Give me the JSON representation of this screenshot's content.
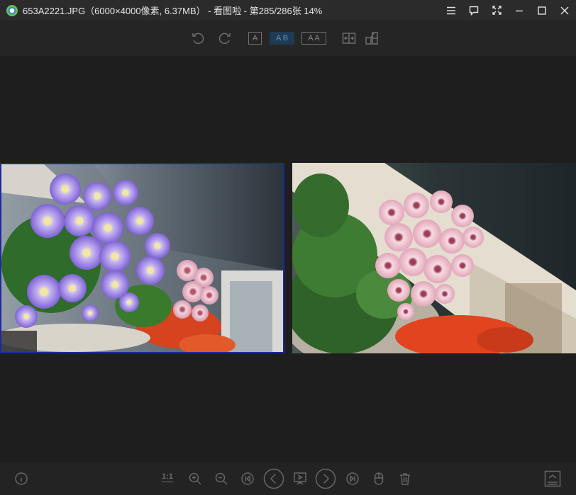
{
  "window": {
    "title": "653A2221.JPG（6000×4000像素, 6.37MB） - 看图啦 - 第285/286张 14%",
    "app_icon": "kantula-logo-icon",
    "controls": [
      "menu-icon",
      "feedback-icon",
      "fullscreen-icon",
      "minimize-icon",
      "maximize-icon",
      "close-icon"
    ]
  },
  "toolbar": {
    "rotate_left": "rotate-left-icon",
    "rotate_right": "rotate-right-icon",
    "single_view_label": "A",
    "compare_ab_label": "A B",
    "compare_aa_label": "A A",
    "sync_icon": "sync-compare-icon",
    "layout_icon": "layout-icon",
    "active_mode": "A B"
  },
  "viewer": {
    "left_image_desc": "purple daisies",
    "right_image_desc": "pink cineraria",
    "selected": "left",
    "accent_color": "#1b2a9c"
  },
  "bottombar": {
    "info_icon": "info-icon",
    "actual_size_label": "1:1",
    "zoom_in": "zoom-in-icon",
    "zoom_out": "zoom-out-icon",
    "first": "first-image-icon",
    "prev": "previous-icon",
    "slideshow": "slideshow-icon",
    "next": "next-icon",
    "last": "last-image-icon",
    "mouse": "mouse-mode-icon",
    "delete": "delete-icon",
    "expand": "thumbnail-bar-icon"
  }
}
